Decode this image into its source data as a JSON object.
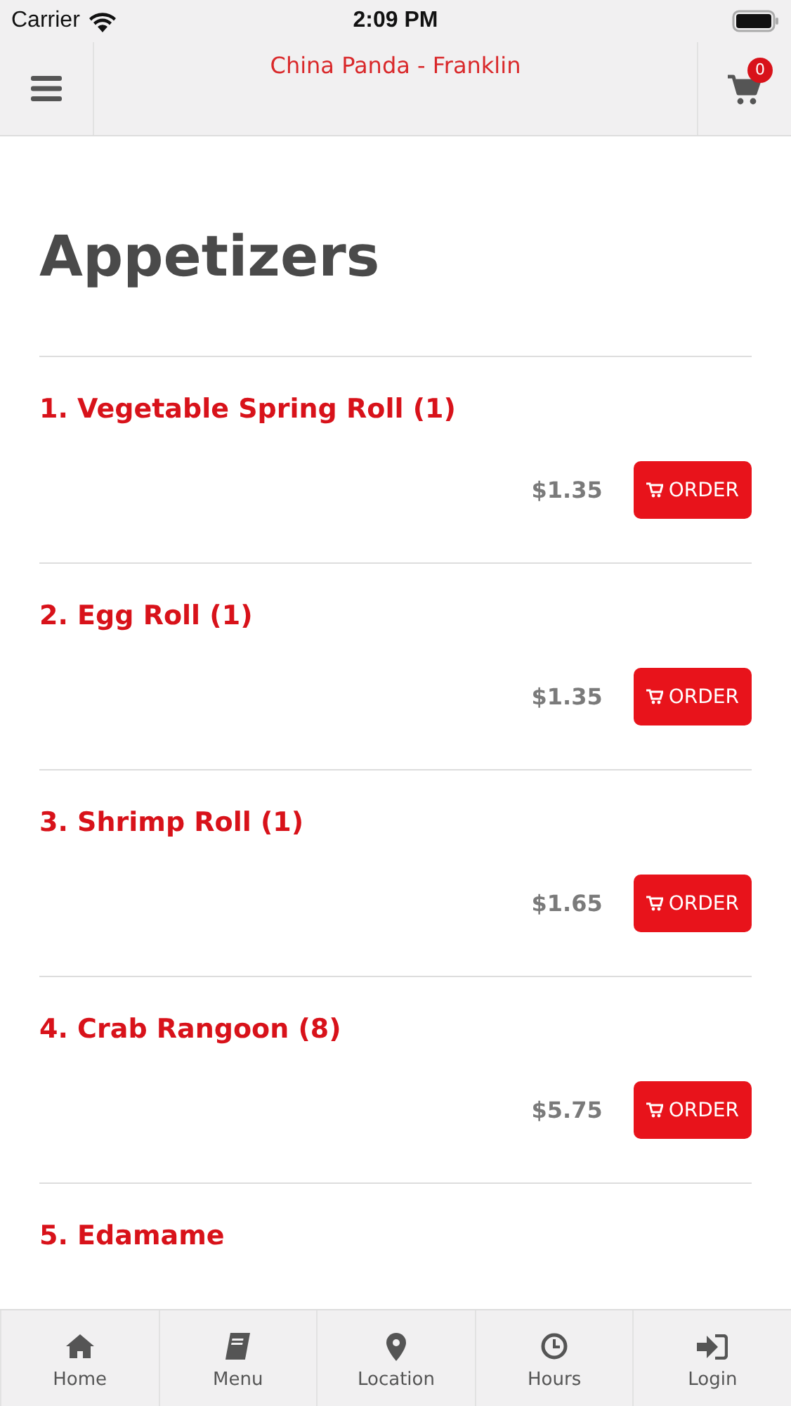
{
  "status_bar": {
    "carrier": "Carrier",
    "time": "2:09 PM"
  },
  "header": {
    "title": "China Panda - Franklin",
    "cart_count": "0"
  },
  "section_title": "Appetizers",
  "items": [
    {
      "name": "1. Vegetable Spring Roll (1)",
      "price": "$1.35",
      "order_label": "ORDER"
    },
    {
      "name": "2. Egg Roll (1)",
      "price": "$1.35",
      "order_label": "ORDER"
    },
    {
      "name": "3. Shrimp Roll (1)",
      "price": "$1.65",
      "order_label": "ORDER"
    },
    {
      "name": "4. Crab Rangoon (8)",
      "price": "$5.75",
      "order_label": "ORDER"
    },
    {
      "name": "5. Edamame"
    }
  ],
  "bottom_nav": [
    {
      "kind": "home",
      "label": "Home"
    },
    {
      "kind": "menu",
      "label": "Menu"
    },
    {
      "kind": "location",
      "label": "Location"
    },
    {
      "kind": "hours",
      "label": "Hours"
    },
    {
      "kind": "login",
      "label": "Login"
    }
  ]
}
